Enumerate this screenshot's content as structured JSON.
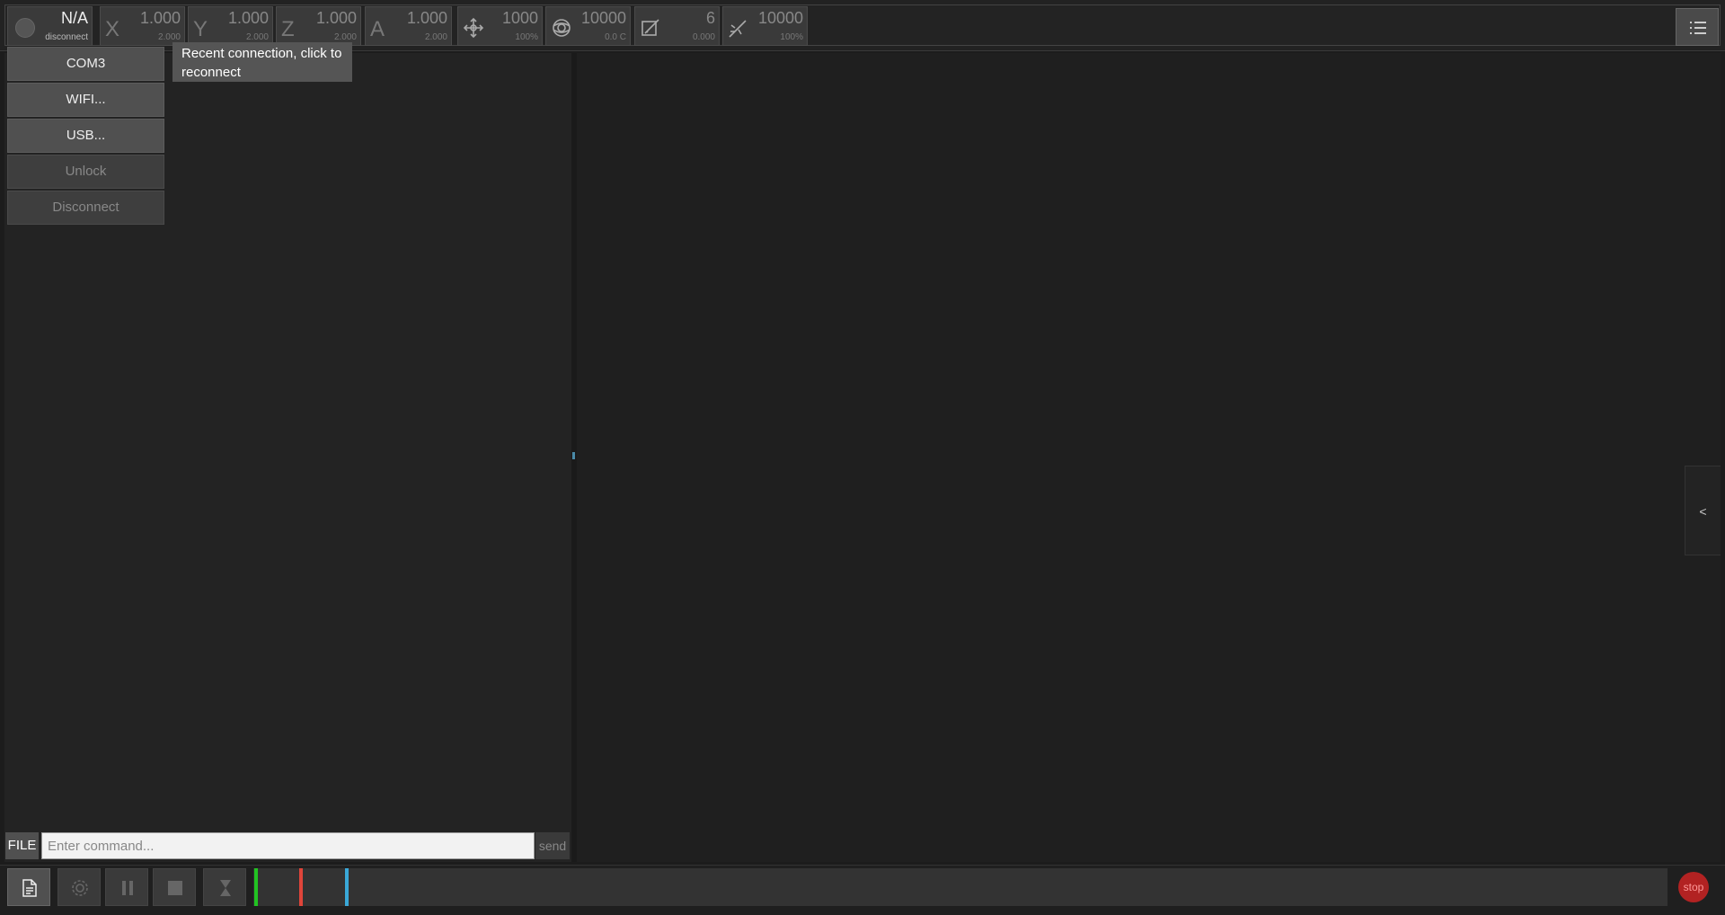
{
  "connection": {
    "status_value": "N/A",
    "status_label": "disconnect"
  },
  "axes": [
    {
      "name": "X",
      "value": "1.000",
      "sub": "2.000"
    },
    {
      "name": "Y",
      "value": "1.000",
      "sub": "2.000"
    },
    {
      "name": "Z",
      "value": "1.000",
      "sub": "2.000"
    },
    {
      "name": "A",
      "value": "1.000",
      "sub": "2.000"
    }
  ],
  "feed": {
    "value": "1000",
    "sub": "100%",
    "icon": "move-arrows-icon"
  },
  "spindle": {
    "value": "10000",
    "sub": "0.0 C",
    "icon": "spindle-icon"
  },
  "tool": {
    "value": "6",
    "sub": "0.000",
    "icon": "tool-edit-icon"
  },
  "laser": {
    "value": "10000",
    "sub": "100%",
    "icon": "laser-icon"
  },
  "dropdown": {
    "items": [
      "COM3",
      "WIFI...",
      "USB...",
      "Unlock",
      "Disconnect"
    ]
  },
  "tooltip": {
    "text": "Recent connection, click to reconnect"
  },
  "side_tab": {
    "label": "<"
  },
  "command": {
    "file_label": "FILE",
    "placeholder": "Enter command...",
    "send_label": "send"
  },
  "stop": {
    "label": "stop"
  },
  "colors": {
    "mark_green": "#22c422",
    "mark_red": "#e0453a",
    "mark_blue": "#3aa8d8",
    "stop": "#b22222"
  }
}
